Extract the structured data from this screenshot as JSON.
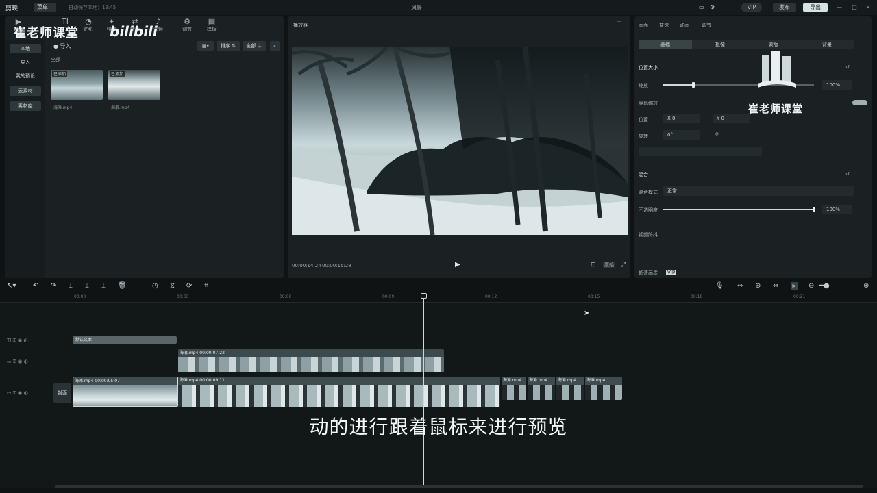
{
  "topbar": {
    "app_name": "剪映",
    "menu_label": "菜单",
    "autosave": "自动保存本地：19:45",
    "project_title": "风景",
    "vip_label": "VIP",
    "share_label": "发布",
    "export_label": "导出",
    "win_controls": [
      "—",
      "□",
      "×"
    ]
  },
  "watermark": {
    "left_text": "崔老师课堂",
    "bili_text": "bilibili",
    "right_text": "崔老师课堂"
  },
  "media": {
    "tabs": [
      {
        "icon": "▶",
        "label": "媒体"
      },
      {
        "icon": "TI",
        "label": "文本"
      },
      {
        "icon": "◔",
        "label": "贴纸"
      },
      {
        "icon": "✦",
        "label": "特效"
      },
      {
        "icon": "⇄",
        "label": "转场"
      },
      {
        "icon": "♪",
        "label": "滤镜"
      },
      {
        "icon": "⚙",
        "label": "调节"
      },
      {
        "icon": "▤",
        "label": "模板"
      }
    ],
    "side": [
      "本地",
      "导入",
      "我的预设",
      "云素材",
      "素材库"
    ],
    "import_label": "导入",
    "all_label": "全部",
    "tools": [
      "▦▾",
      "排序 ⇅",
      "全部 ⏚"
    ],
    "items": [
      {
        "tag": "已添加",
        "name": "海滩.mp4"
      },
      {
        "tag": "已添加",
        "name": "海浪.mp4"
      }
    ]
  },
  "player": {
    "header": "播放器",
    "current_time": "00:00:14:24",
    "total_time": "00:00:15:28",
    "ratio_label": "原始"
  },
  "props": {
    "tabs": [
      "画面",
      "变速",
      "动画",
      "调节"
    ],
    "segments": [
      "基础",
      "抠像",
      "蒙版",
      "背景"
    ],
    "position_size": "位置大小",
    "scale_label": "缩放",
    "scale_value": "100%",
    "scale_level": 0.2,
    "uniform_label": "等比缩放",
    "position_label": "位置",
    "pos_x": "X  0",
    "pos_y": "Y  0",
    "rotate_label": "旋转",
    "rotate_value": "0°",
    "blend_title": "混合",
    "blend_mode_label": "混合模式",
    "blend_mode_value": "正常",
    "opacity_label": "不透明度",
    "opacity_value": "100%",
    "opacity_level": 1.0,
    "anti_shake": "视频防抖",
    "super_res": "超清画质",
    "badge": "VIP"
  },
  "timeline": {
    "ruler_labels": [
      "00:00",
      "00:03",
      "00:06",
      "00:09",
      "00:12",
      "00:15",
      "00:18",
      "00:21"
    ],
    "text_clip": "默认文本",
    "overlay_clip": "海浪.mp4  00:00:07:22",
    "main_clip_1": "海滩.mp4  00:00:05:07",
    "main_clip_2": "海滩.mp4  00:00:09:11",
    "tail_clips": [
      "海滩.mp4",
      "海滩.mp4",
      "海滩.mp4",
      "海滩.mp4"
    ],
    "cover_label": "封面",
    "subtitle": "动的进行跟着鼠标来进行预览"
  }
}
